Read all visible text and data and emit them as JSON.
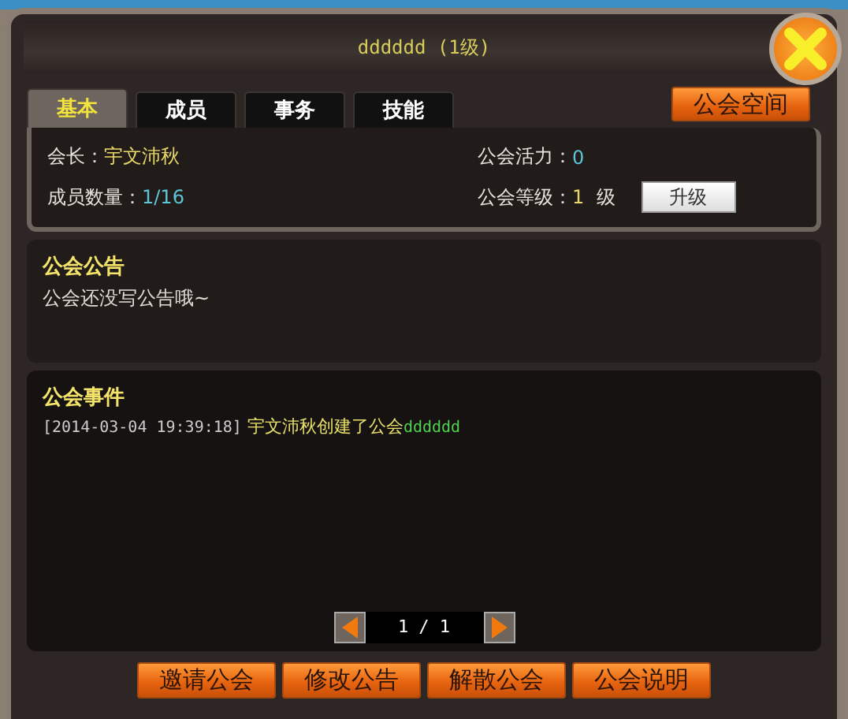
{
  "window": {
    "title": "dddddd (1级)"
  },
  "tabs": [
    {
      "label": "基本",
      "selected": true
    },
    {
      "label": "成员",
      "selected": false
    },
    {
      "label": "事务",
      "selected": false
    },
    {
      "label": "技能",
      "selected": false
    }
  ],
  "space_button": "公会空间",
  "info": {
    "leader_label": "会长：",
    "leader": "宇文沛秋",
    "members_label": "成员数量：",
    "members": "1/16",
    "activity_label": "公会活力：",
    "activity": "0",
    "level_label": "公会等级：",
    "level_value": "1",
    "level_unit": "级",
    "upgrade_button": "升级"
  },
  "notice": {
    "title": "公会公告",
    "text": "公会还没写公告哦~"
  },
  "events": {
    "title": "公会事件",
    "entries": [
      {
        "time": "[2014-03-04 19:39:18]",
        "text": "宇文沛秋创建了公会",
        "guild": "dddddd"
      }
    ]
  },
  "pager": {
    "text": "1 / 1"
  },
  "buttons": [
    "邀请公会",
    "修改公告",
    "解散公会",
    "公会说明"
  ]
}
